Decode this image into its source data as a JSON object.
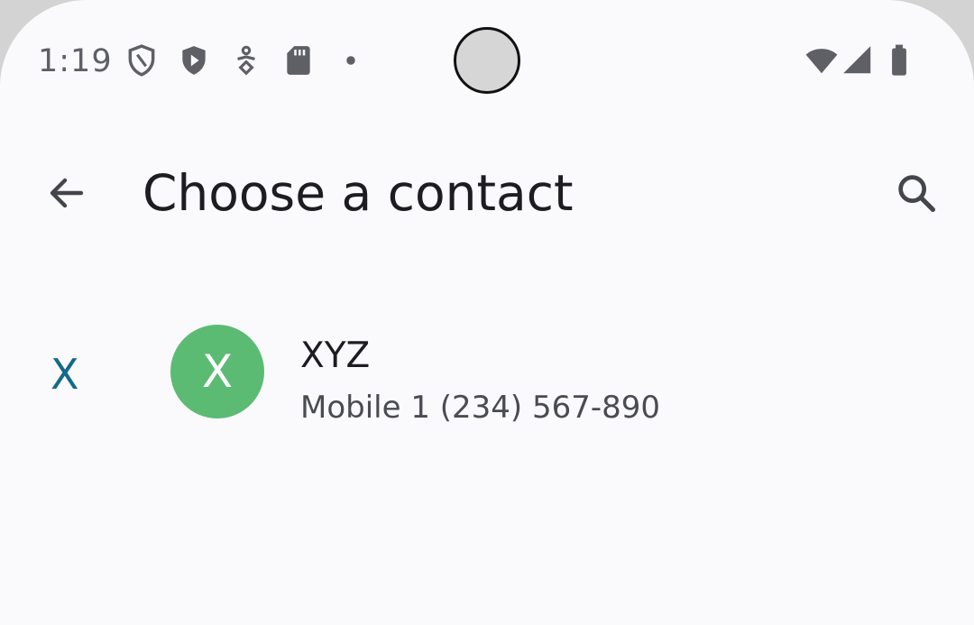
{
  "status_bar": {
    "time": "1:19",
    "icons": [
      "shield-icon",
      "play-protect-icon",
      "accessibility-icon",
      "sd-card-icon",
      "dot-icon"
    ],
    "right_icons": [
      "wifi-icon",
      "cellular-signal-icon",
      "battery-icon"
    ]
  },
  "app_bar": {
    "title": "Choose a contact",
    "back_icon": "arrow-back-icon",
    "search_icon": "search-icon"
  },
  "contacts": [
    {
      "section_letter": "X",
      "avatar_letter": "X",
      "avatar_color": "#5bbb73",
      "name": "XYZ",
      "detail": "Mobile 1 (234) 567-890"
    }
  ],
  "colors": {
    "background": "#fafafd",
    "section_letter": "#146a8a"
  }
}
